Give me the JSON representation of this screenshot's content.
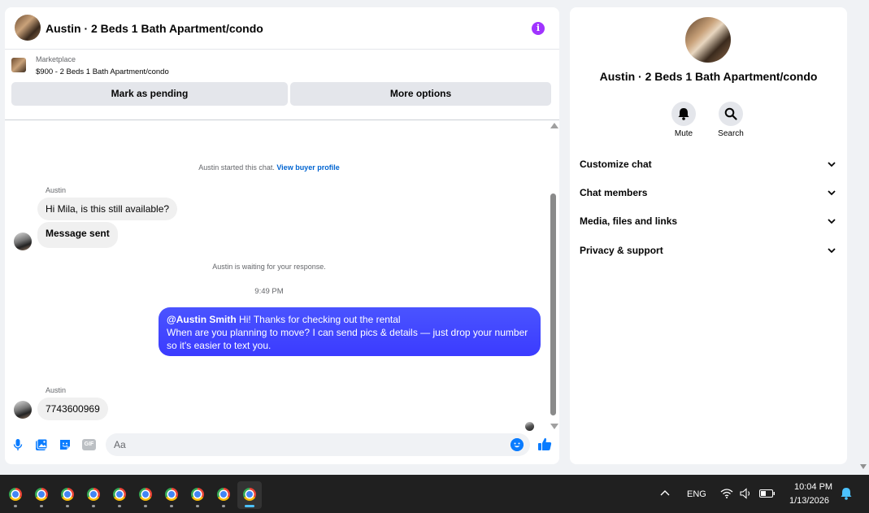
{
  "chat": {
    "title": "Austin · 2 Beds 1 Bath Apartment/condo",
    "info_icon": "info-icon",
    "listing": {
      "source": "Marketplace",
      "title": "$900 - 2 Beds 1 Bath Apartment/condo",
      "mark_pending_label": "Mark as pending",
      "more_options_label": "More options"
    },
    "messages": {
      "started_text": "Austin started this chat.",
      "view_profile_link": "View buyer profile",
      "sender_name_1": "Austin",
      "incoming_1": "Hi Mila, is this still available?",
      "incoming_2": "Message sent",
      "waiting_text": "Austin is waiting for your response.",
      "timestamp": "9:49 PM",
      "outgoing_mention": "@Austin Smith",
      "outgoing_line1": " Hi! Thanks for checking out the rental",
      "outgoing_line2": "When are you planning to move? I can send pics & details — just drop your number so it's easier to text you.",
      "sender_name_2": "Austin",
      "incoming_3": "7743600969"
    },
    "composer": {
      "placeholder": "Aa",
      "icons": [
        "microphone-icon",
        "photo-icon",
        "sticker-icon",
        "gif-icon",
        "emoji-icon",
        "thumbs-up-icon"
      ],
      "gif_label": "GIF"
    }
  },
  "side_panel": {
    "title": "Austin · 2 Beds 1 Bath Apartment/condo",
    "actions": [
      {
        "label": "Mute",
        "icon": "bell-icon"
      },
      {
        "label": "Search",
        "icon": "search-icon"
      }
    ],
    "sections": [
      {
        "label": "Customize chat"
      },
      {
        "label": "Chat members"
      },
      {
        "label": "Media, files and links"
      },
      {
        "label": "Privacy & support"
      }
    ]
  },
  "taskbar": {
    "app_count": 10,
    "app_icon": "chrome-icon",
    "tray": {
      "language": "ENG",
      "time": "10:04 PM",
      "date": "1/13/2026"
    }
  },
  "colors": {
    "accent": "#0a7cff",
    "outgoing_bubble": "#3e4dff",
    "info_icon": "#a033ff",
    "link": "#0064d1"
  }
}
